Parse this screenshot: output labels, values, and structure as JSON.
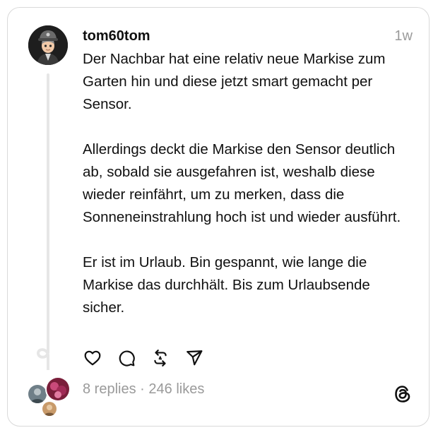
{
  "post": {
    "username": "tom60tom",
    "timestamp": "1w",
    "paragraphs": [
      "Der Nachbar hat eine relativ neue Markise zum Garten hin und diese jetzt smart gemacht per Sensor.",
      "Allerdings deckt die Markise den Sensor deutlich ab, sobald sie ausgefahren ist, weshalb diese wieder reinfährt, um zu merken, dass die Sonneneinstrahlung hoch ist und wieder ausführt.",
      "Er ist im Urlaub. Bin gespannt, wie lange die Markise das durchhält. Bis zum Urlaubsende sicher."
    ]
  },
  "actions": {
    "like_icon": "heart-icon",
    "reply_icon": "comment-icon",
    "repost_icon": "repost-icon",
    "share_icon": "send-icon"
  },
  "stats": {
    "replies": "8 replies",
    "separator": " · ",
    "likes": "246 likes"
  },
  "colors": {
    "text": "#101010",
    "muted": "#9a9a9a",
    "border": "#d9d9d9",
    "thread_line": "#e6e6e6"
  },
  "footer": {
    "logo_icon": "threads-logo-icon"
  }
}
